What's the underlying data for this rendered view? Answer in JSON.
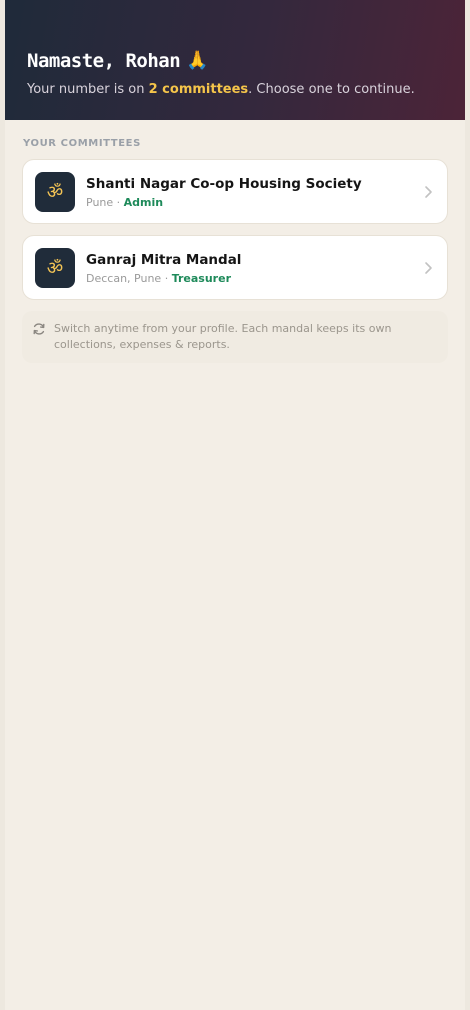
{
  "header": {
    "greeting": "Namaste, Rohan",
    "greeting_emoji": "🙏",
    "subtitle_prefix": "Your number is on ",
    "subtitle_highlight": "2 committees",
    "subtitle_suffix": ". Choose one to continue."
  },
  "section_label": "YOUR COMMITTEES",
  "committees": [
    {
      "logo": "ॐ",
      "name": "Shanti Nagar Co-op Housing Society",
      "location": "Pune",
      "separator": " · ",
      "role": "Admin"
    },
    {
      "logo": "ॐ",
      "name": "Ganraj Mitra Mandal",
      "location": "Deccan, Pune",
      "separator": " · ",
      "role": "Treasurer"
    }
  ],
  "note": {
    "icon": "refresh-icon",
    "text": "Switch anytime from your profile. Each mandal keeps its own collections, expenses & reports."
  },
  "colors": {
    "accent_gold": "#f5c54a",
    "role_green": "#1e8a5a",
    "logo_bg": "#202c3a"
  }
}
